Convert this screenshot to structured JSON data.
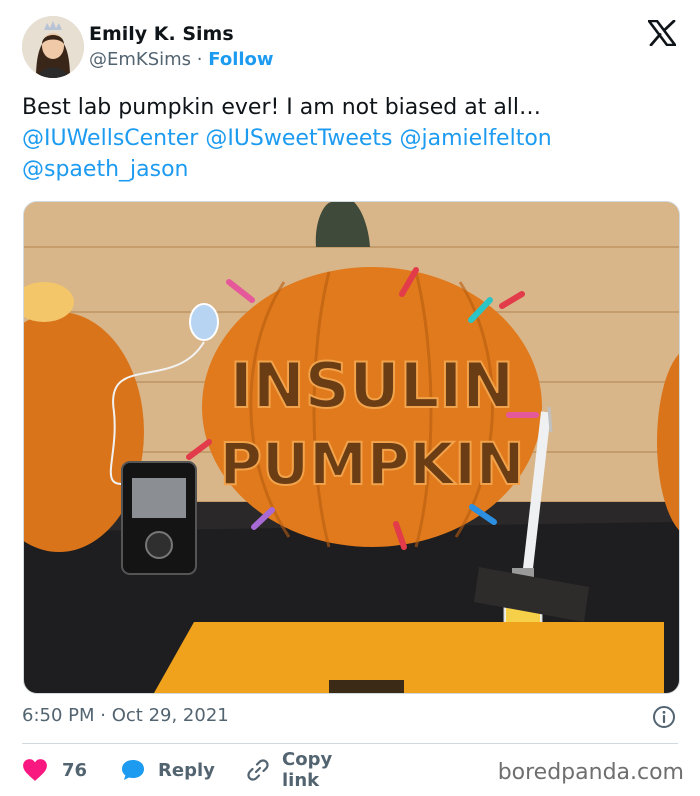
{
  "author": {
    "name": "Emily K. Sims",
    "handle": "@EmKSims",
    "separator": "·",
    "follow_label": "Follow"
  },
  "tweet": {
    "text": "Best lab pumpkin ever! I am not biased at all…",
    "mentions": [
      "@IUWellsCenter",
      "@IUSweetTweets",
      "@jamielfelton",
      "@spaeth_jason"
    ]
  },
  "photo": {
    "carved_text_line1": "INSULIN",
    "carved_text_line2": "PUMPKIN"
  },
  "meta": {
    "time": "6:50 PM",
    "separator": "·",
    "date": "Oct 29, 2021"
  },
  "actions": {
    "like_count": "76",
    "reply_label": "Reply",
    "copy_link_label": "Copy link"
  },
  "watermark": "boredpanda.com",
  "colors": {
    "link": "#1d9bf0",
    "like": "#f91880",
    "secondary_text": "#536471",
    "pumpkin": "#e07a1c"
  },
  "icons": [
    "x-logo-icon",
    "heart-icon",
    "reply-bubble-icon",
    "link-icon",
    "info-icon"
  ]
}
